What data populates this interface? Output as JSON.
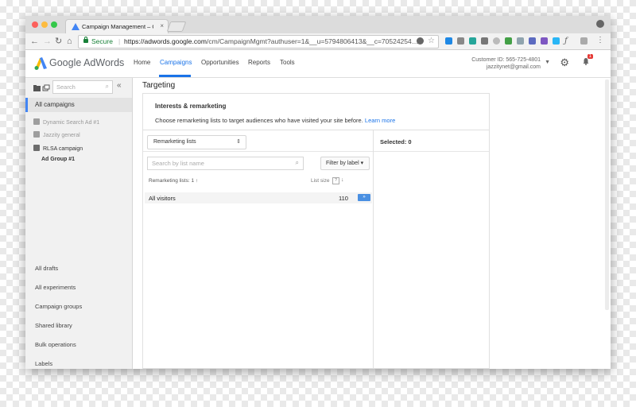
{
  "browser": {
    "tab_title": "Campaign Management – Goo",
    "tab_close": "×",
    "secure_label": "Secure",
    "url_host": "https://adwords.google.com",
    "url_path": "/cm/CampaignMgmt?authuser=1&__u=5794806413&__c=70524254…",
    "menu": "⋮"
  },
  "header": {
    "logo_text": "Google AdWords",
    "nav": [
      "Home",
      "Campaigns",
      "Opportunities",
      "Reports",
      "Tools"
    ],
    "active_nav": "Campaigns",
    "customer_id": "Customer ID: 565-725-4801",
    "email": "jazzitynet@gmail.com",
    "notification_count": "1"
  },
  "sidebar": {
    "search_placeholder": "Search",
    "all_campaigns": "All campaigns",
    "campaigns": [
      {
        "label": "Dynamic Search Ad #1",
        "status": "paused"
      },
      {
        "label": "Jazzity general",
        "status": "paused"
      },
      {
        "label": "RLSA campaign",
        "status": "enabled"
      }
    ],
    "ad_group": "Ad Group #1",
    "links": [
      "All drafts",
      "All experiments",
      "Campaign groups",
      "Shared library",
      "Bulk operations",
      "Labels"
    ]
  },
  "main": {
    "heading": "Targeting",
    "card_title": "Interests & remarketing",
    "card_desc": "Choose remarketing lists to target audiences who have visited your site before.",
    "learn_more": "Learn more",
    "list_type_select": "Remarketing lists",
    "search_placeholder": "Search by list name",
    "filter_label": "Filter by label ▾",
    "count_label": "Remarketing lists: 1",
    "list_size_label": "List size",
    "rows": [
      {
        "name": "All visitors",
        "size": "110"
      }
    ],
    "selected_label": "Selected: 0"
  },
  "colors": {
    "accent": "#1a73e8",
    "secure": "#188038",
    "add_button": "#4a90e2",
    "badge": "#e53935"
  }
}
